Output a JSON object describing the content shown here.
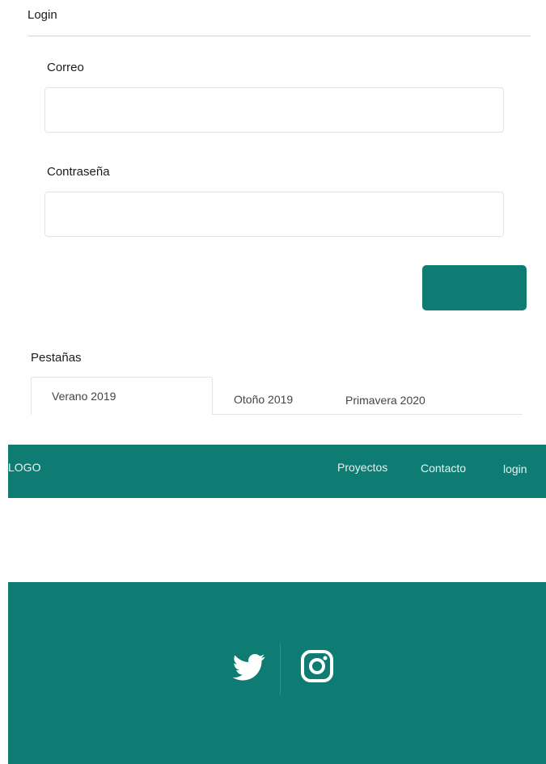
{
  "login": {
    "title": "Login",
    "email_label": "Correo",
    "email_value": "",
    "password_label": "Contraseña",
    "password_value": "",
    "submit_label": ""
  },
  "tabs": {
    "title": "Pestañas",
    "items": [
      {
        "label": "Verano 2019",
        "active": true
      },
      {
        "label": "Otoño 2019",
        "active": false
      },
      {
        "label": "Primavera 2020",
        "active": false
      }
    ]
  },
  "navbar": {
    "logo": "LOGO",
    "links": [
      {
        "label": "Proyectos"
      },
      {
        "label": "Contacto"
      },
      {
        "label": "login"
      }
    ]
  },
  "footer": {
    "icons": [
      "twitter-icon",
      "instagram-icon"
    ]
  },
  "colors": {
    "brand": "#0e7c73",
    "text": "#1b1b1b",
    "border": "#e3e3e3",
    "nav_text": "#e6f4f1"
  }
}
